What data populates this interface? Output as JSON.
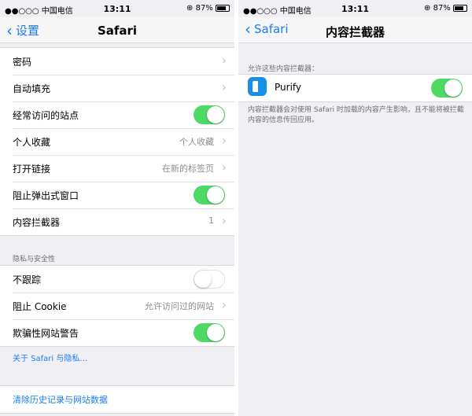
{
  "status": {
    "carrier": "●●○○○ 中国电信",
    "time": "13:11",
    "battery": "87%"
  },
  "left": {
    "nav": {
      "back_label": "设置",
      "title": "Safari"
    },
    "general_rows": [
      {
        "label": "密码",
        "value": "",
        "control": "chevron"
      },
      {
        "label": "自动填充",
        "value": "",
        "control": "chevron"
      },
      {
        "label": "经常访问的站点",
        "value": "",
        "control": "toggle-on"
      },
      {
        "label": "个人收藏",
        "value": "个人收藏",
        "control": "chevron"
      },
      {
        "label": "打开链接",
        "value": "在新的标签页",
        "control": "chevron"
      },
      {
        "label": "阻止弹出式窗口",
        "value": "",
        "control": "toggle-on"
      },
      {
        "label": "内容拦截器",
        "value": "1",
        "control": "chevron"
      }
    ],
    "privacy_header": "隐私与安全性",
    "privacy_rows": [
      {
        "label": "不跟踪",
        "value": "",
        "control": "toggle-off"
      },
      {
        "label": "阻止 Cookie",
        "value": "允许访问过的网站",
        "control": "chevron"
      },
      {
        "label": "欺骗性网站警告",
        "value": "",
        "control": "toggle-on"
      }
    ],
    "about_link": "关于 Safari 与隐私…",
    "clear_history": "清除历史记录与网站数据"
  },
  "right": {
    "nav": {
      "back_label": "Safari",
      "title": "内容拦截器"
    },
    "section_header": "允许这些内容拦截器：",
    "app": {
      "name": "Purify",
      "icon": "purify-app-icon",
      "enabled": true
    },
    "footer": "内容拦截器会对使用 Safari 时加载的内容产生影响，且不能将被拦截内容的信息传回应用。"
  },
  "colors": {
    "accent": "#1a7cf5",
    "toggle_on": "#4cd964",
    "background": "#efeff4"
  }
}
